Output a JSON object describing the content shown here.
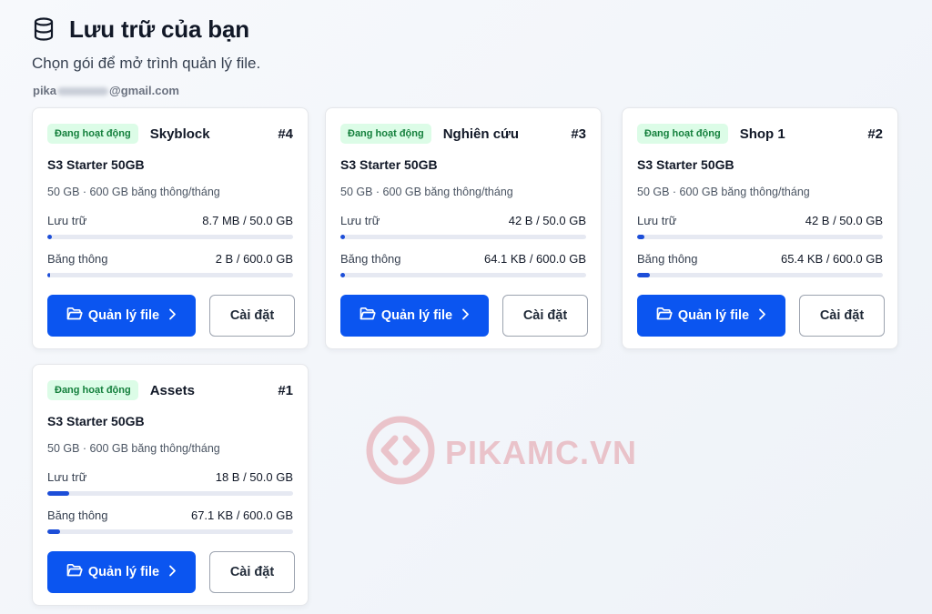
{
  "page": {
    "title": "Lưu trữ của bạn",
    "subtitle": "Chọn gói để mở trình quản lý file.",
    "email_prefix": "pika",
    "email_suffix": "@gmail.com"
  },
  "colors": {
    "accent": "#0b55f0",
    "badge_bg": "#dcfce7",
    "badge_text": "#15803d",
    "watermark": "#d64550"
  },
  "icons": {
    "header": "database-icon",
    "primary_button": "folder-open-icon",
    "primary_chevron": "chevron-right-icon"
  },
  "watermark": {
    "text": "PIKAMC.VN"
  },
  "labels": {
    "storage": "Lưu trữ",
    "bandwidth": "Băng thông",
    "manage": "Quản lý file",
    "settings": "Cài đặt"
  },
  "cards": [
    {
      "status": "Đang hoạt động",
      "name": "Skyblock",
      "number": "#4",
      "plan": "S3 Starter 50GB",
      "spec": "50 GB · 600 GB băng thông/tháng",
      "storage": "8.7 MB / 50.0 GB",
      "bandwidth": "2 B / 600.0 GB",
      "storage_pct": 0.02,
      "bandwidth_pct": 0.004
    },
    {
      "status": "Đang hoạt động",
      "name": "Nghiên cứu",
      "number": "#3",
      "plan": "S3 Starter 50GB",
      "spec": "50 GB · 600 GB băng thông/tháng",
      "storage": "42 B / 50.0 GB",
      "bandwidth": "64.1 KB / 600.0 GB",
      "storage_pct": 0.02,
      "bandwidth_pct": 0.02
    },
    {
      "status": "Đang hoạt động",
      "name": "Shop 1",
      "number": "#2",
      "plan": "S3 Starter 50GB",
      "spec": "50 GB · 600 GB băng thông/tháng",
      "storage": "42 B / 50.0 GB",
      "bandwidth": "65.4 KB / 600.0 GB",
      "storage_pct": 0.03,
      "bandwidth_pct": 0.05
    },
    {
      "status": "Đang hoạt động",
      "name": "Assets",
      "number": "#1",
      "plan": "S3 Starter 50GB",
      "spec": "50 GB · 600 GB băng thông/tháng",
      "storage": "18 B / 50.0 GB",
      "bandwidth": "67.1 KB / 600.0 GB",
      "storage_pct": 0.09,
      "bandwidth_pct": 0.05
    }
  ]
}
